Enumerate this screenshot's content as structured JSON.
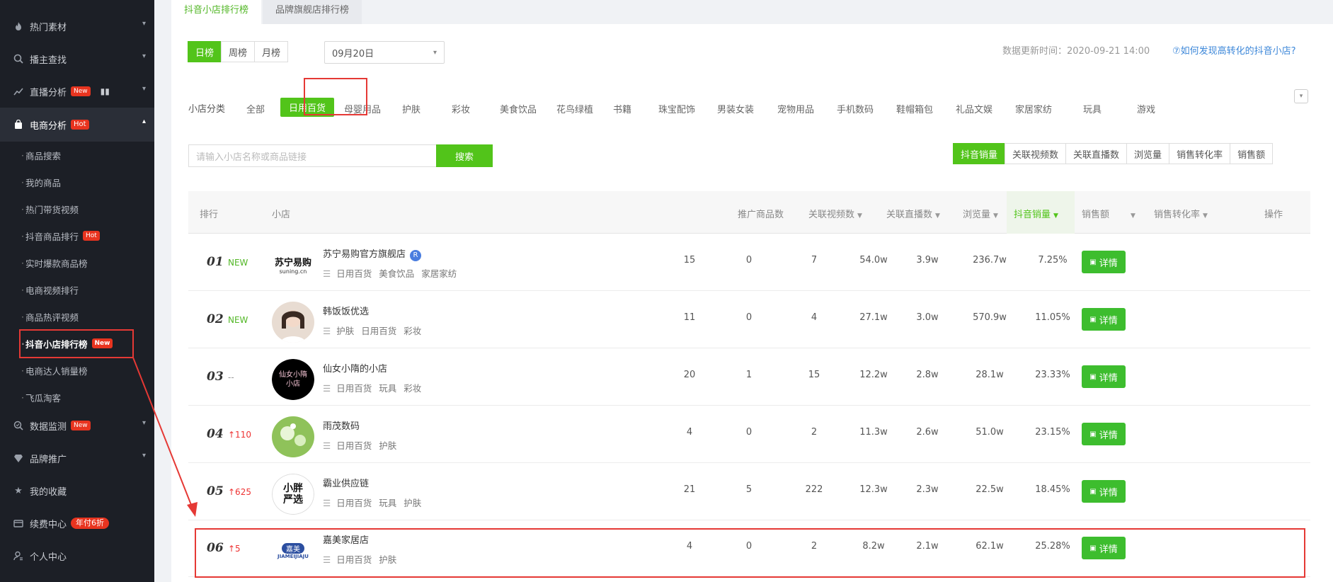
{
  "colors": {
    "accent": "#52c41a",
    "sidebar_bg": "#1c1f26",
    "highlight_red": "#e53935"
  },
  "sidebar": {
    "items": [
      {
        "label": "热门素材",
        "icon": "flame-icon"
      },
      {
        "label": "播主查找",
        "icon": "search-icon"
      },
      {
        "label": "直播分析",
        "icon": "trend-icon",
        "badge": "New"
      },
      {
        "label": "电商分析",
        "icon": "bag-icon",
        "badge": "Hot"
      },
      {
        "label": "数据监测",
        "icon": "monitor-icon",
        "badge": "New"
      },
      {
        "label": "品牌推广",
        "icon": "diamond-icon"
      },
      {
        "label": "我的收藏",
        "icon": "star-icon"
      },
      {
        "label": "续费中心",
        "icon": "card-icon",
        "badge": "年付6折"
      },
      {
        "label": "个人中心",
        "icon": "user-icon"
      }
    ],
    "sub_items": [
      {
        "label": "商品搜索"
      },
      {
        "label": "我的商品"
      },
      {
        "label": "热门带货视频"
      },
      {
        "label": "抖音商品排行",
        "badge": "Hot"
      },
      {
        "label": "实时爆款商品榜"
      },
      {
        "label": "电商视频排行"
      },
      {
        "label": "商品热评视频"
      },
      {
        "label": "抖音小店排行榜",
        "badge": "New"
      },
      {
        "label": "电商达人销量榜"
      },
      {
        "label": "飞瓜淘客"
      }
    ]
  },
  "tabs": [
    {
      "label": "抖音小店排行榜"
    },
    {
      "label": "品牌旗舰店排行榜"
    }
  ],
  "period": {
    "options": [
      "日榜",
      "周榜",
      "月榜"
    ],
    "selected": "日榜"
  },
  "date": "09月20日",
  "update_time": "数据更新时间：2020-09-21 14:00",
  "help_link": "⑦如何发现高转化的抖音小店?",
  "category": {
    "label": "小店分类",
    "items": [
      "全部",
      "日用百货",
      "母婴用品",
      "护肤",
      "彩妆",
      "美食饮品",
      "花鸟绿植",
      "书籍",
      "珠宝配饰",
      "男装女装",
      "宠物用品",
      "手机数码",
      "鞋帽箱包",
      "礼品文娱",
      "家居家纺",
      "玩具",
      "游戏"
    ],
    "selected": "日用百货"
  },
  "search": {
    "placeholder": "请输入小店名称或商品链接",
    "button": "搜索"
  },
  "sort_buttons": [
    "抖音销量",
    "关联视频数",
    "关联直播数",
    "浏览量",
    "销售转化率",
    "销售额"
  ],
  "table": {
    "headers": {
      "rank": "排行",
      "shop": "小店",
      "products": "推广商品数",
      "videos": "关联视频数",
      "lives": "关联直播数",
      "views": "浏览量",
      "sales": "抖音销量",
      "revenue": "销售额",
      "conversion": "销售转化率",
      "action": "操作"
    },
    "detail_label": "详情",
    "rows": [
      {
        "rank": "01",
        "trend": "NEW",
        "trend_type": "new",
        "name": "苏宁易购官方旗舰店",
        "verified": "R",
        "tags": [
          "日用百货",
          "美食饮品",
          "家居家纺"
        ],
        "products": "15",
        "videos": "0",
        "lives": "7",
        "views": "54.0w",
        "sales": "3.9w",
        "revenue": "236.7w",
        "conversion": "7.25%",
        "avatar_text": "苏宁易购",
        "avatar_sub": "suning.cn"
      },
      {
        "rank": "02",
        "trend": "NEW",
        "trend_type": "new",
        "name": "韩饭饭优选",
        "tags": [
          "护肤",
          "日用百货",
          "彩妆"
        ],
        "products": "11",
        "videos": "0",
        "lives": "4",
        "views": "27.1w",
        "sales": "3.0w",
        "revenue": "570.9w",
        "conversion": "11.05%"
      },
      {
        "rank": "03",
        "trend": "--",
        "trend_type": "flat",
        "name": "仙女小隋的小店",
        "tags": [
          "日用百货",
          "玩具",
          "彩妆"
        ],
        "products": "20",
        "videos": "1",
        "lives": "15",
        "views": "12.2w",
        "sales": "2.8w",
        "revenue": "28.1w",
        "conversion": "23.33%",
        "avatar_text": "仙女小隋小店"
      },
      {
        "rank": "04",
        "trend": "↑110",
        "trend_type": "up",
        "name": "雨茂数码",
        "tags": [
          "日用百货",
          "护肤"
        ],
        "products": "4",
        "videos": "0",
        "lives": "2",
        "views": "11.3w",
        "sales": "2.6w",
        "revenue": "51.0w",
        "conversion": "23.15%"
      },
      {
        "rank": "05",
        "trend": "↑625",
        "trend_type": "up",
        "name": "霸业供应链",
        "tags": [
          "日用百货",
          "玩具",
          "护肤"
        ],
        "products": "21",
        "videos": "5",
        "lives": "222",
        "views": "12.3w",
        "sales": "2.3w",
        "revenue": "22.5w",
        "conversion": "18.45%",
        "avatar_text": "小胖严选"
      },
      {
        "rank": "06",
        "trend": "↑5",
        "trend_type": "up",
        "name": "嘉美家居店",
        "tags": [
          "日用百货",
          "护肤"
        ],
        "products": "4",
        "videos": "0",
        "lives": "2",
        "views": "8.2w",
        "sales": "2.1w",
        "revenue": "62.1w",
        "conversion": "25.28%",
        "avatar_text": "嘉美",
        "avatar_sub": "JIAMEIJIAJU"
      }
    ]
  }
}
